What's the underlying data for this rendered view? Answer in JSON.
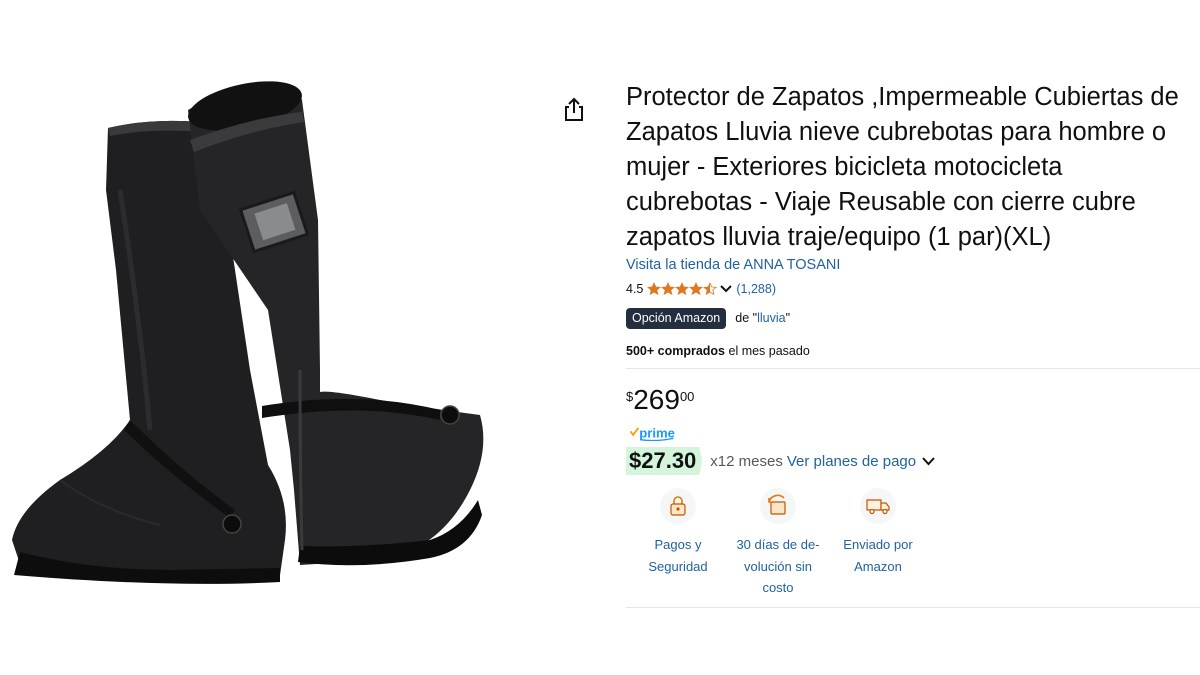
{
  "product": {
    "title": "Protector de Zapatos ,Impermeable Cubiertas de Zapatos Lluvia nieve cubrebotas para hombre o mujer - Exteriores bicicleta motocicleta cubrebotas - Viaje Reusable con cierre cubre zapatos lluvia traje/equipo (1 par)(XL)",
    "store_link": "Visita la tienda de ANNA TOSANI",
    "rating": "4.5",
    "rating_count": "(1,288)",
    "stars": 4.5,
    "choice_badge": "Opción Amazon",
    "choice_for_prefix": "de \"",
    "choice_keyword": "lluvia",
    "choice_for_suffix": "\"",
    "bought_bold": "500+ comprados",
    "bought_rest": " el mes pasado",
    "price_symbol": "$",
    "price_whole": "269",
    "price_fraction": "00",
    "installment_amount": "$27.30",
    "installment_months": "x12 meses",
    "installment_link": "Ver planes de pago",
    "features": [
      {
        "icon": "secure-payment-icon",
        "label": "Pagos y Seguridad"
      },
      {
        "icon": "return-icon",
        "label": "30 días de de-volución sin costo"
      },
      {
        "icon": "delivery-truck-icon",
        "label": "Enviado por Amazon"
      }
    ]
  },
  "colors": {
    "link": "#2162a1",
    "star": "#de7921",
    "choice_badge_bg": "#232f3e",
    "installment_bg": "#d4f5dc",
    "prime_blue": "#1a98ff"
  },
  "icons": [
    "share-icon",
    "chevron-down-icon",
    "prime-logo",
    "secure-payment-icon",
    "return-icon",
    "delivery-truck-icon"
  ]
}
